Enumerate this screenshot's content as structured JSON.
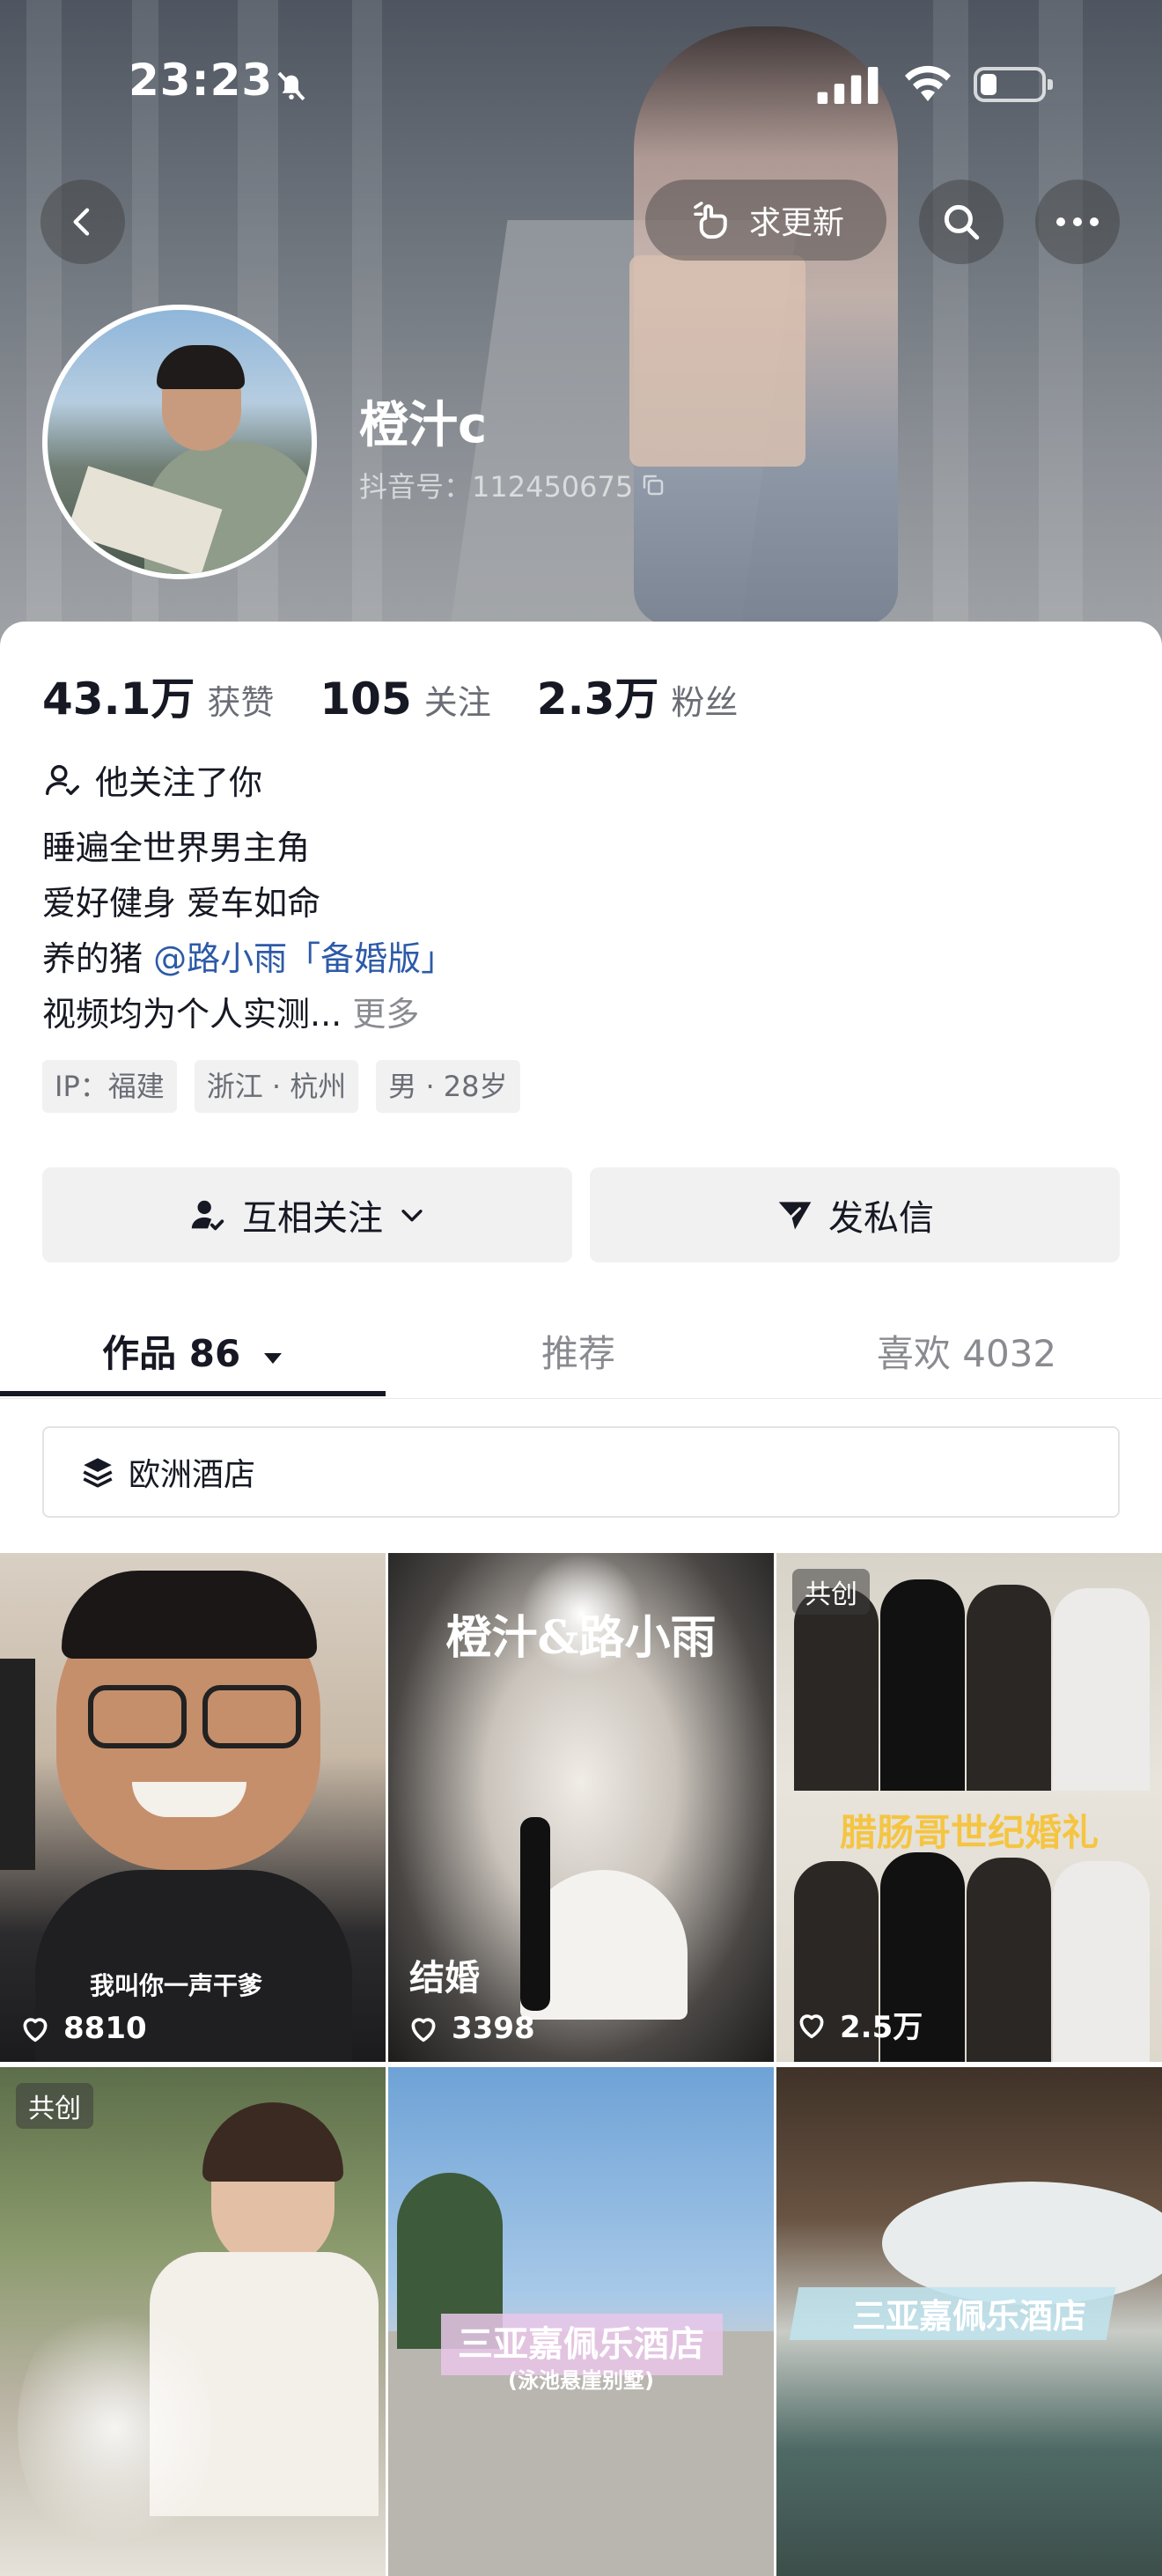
{
  "status_bar": {
    "time": "23:23"
  },
  "header": {
    "request_update_label": "求更新",
    "username": "橙汁c",
    "douyin_id": "抖音号：112450675"
  },
  "stats": [
    {
      "value": "43.1万",
      "label": "获赞"
    },
    {
      "value": "105",
      "label": "关注"
    },
    {
      "value": "2.3万",
      "label": "粉丝"
    }
  ],
  "follows_you": "他关注了你",
  "bio": {
    "line1": "睡遍全世界男主角",
    "line2": "爱好健身 爱车如命",
    "line3_prefix": "养的猪 ",
    "line3_mention": "@路小雨「备婚版」",
    "line4": "视频均为个人实测...",
    "more": "更多"
  },
  "tags": [
    "IP：福建",
    "浙江 · 杭州",
    "男 · 28岁"
  ],
  "actions": {
    "mutual_follow": "互相关注",
    "message": "发私信"
  },
  "tabs": {
    "works": "作品 86",
    "recommend": "推荐",
    "likes": "喜欢 4032"
  },
  "collection_label": "欧洲酒店",
  "grid": {
    "items": [
      {
        "likes": "8810",
        "caption": "我叫你一声干爹"
      },
      {
        "likes": "3398",
        "title": "橙汁&路小雨",
        "caption": "结婚"
      },
      {
        "likes": "2.5万",
        "badge": "共创",
        "title": "腊肠哥世纪婚礼"
      },
      {
        "badge": "共创"
      },
      {
        "title": "三亚嘉佩乐酒店",
        "subtitle": "(泳池悬崖别墅)"
      },
      {
        "title": "三亚嘉佩乐酒店"
      }
    ]
  },
  "colors": {
    "mention": "#2c5aa8",
    "text": "#161823",
    "muted": "#8a8b91",
    "button_bg": "#f1f1f2"
  }
}
